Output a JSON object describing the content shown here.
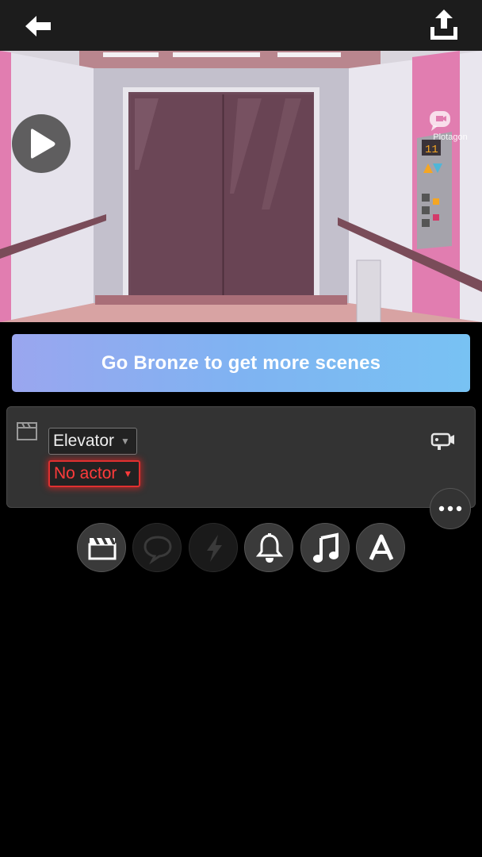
{
  "topbar": {
    "back_icon": "back-arrow-icon",
    "share_icon": "share-upload-icon"
  },
  "scene_preview": {
    "setting": "Elevator",
    "play_icon": "play-icon",
    "watermark": "Plotagon",
    "floor_display": "11"
  },
  "promo": {
    "label": "Go Bronze to get more scenes",
    "gradient": [
      "#9aa6ef",
      "#78c2f3"
    ]
  },
  "scene_card": {
    "location": "Elevator",
    "actor": "No actor",
    "actor_color": "#ff3b3b",
    "icons": [
      "clapperboard-icon",
      "camera-icon",
      "more-icon"
    ]
  },
  "toolbar": {
    "tools": [
      {
        "name": "scene",
        "icon": "clapperboard-icon",
        "enabled": true
      },
      {
        "name": "dialogue",
        "icon": "speech-bubble-icon",
        "enabled": false
      },
      {
        "name": "action",
        "icon": "lightning-icon",
        "enabled": false
      },
      {
        "name": "sound-effect",
        "icon": "bell-icon",
        "enabled": true
      },
      {
        "name": "music",
        "icon": "music-note-icon",
        "enabled": true
      },
      {
        "name": "text",
        "icon": "text-a-icon",
        "enabled": true
      }
    ]
  }
}
